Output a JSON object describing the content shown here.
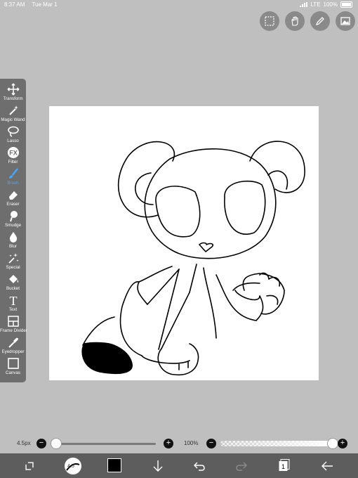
{
  "status_bar": {
    "time": "8:37 AM",
    "date": "Tue Mar 1",
    "network": "LTE",
    "battery": "100%"
  },
  "top_buttons": [
    "selection-icon",
    "hand-icon",
    "pencil-icon",
    "image-icon"
  ],
  "tools": [
    {
      "label": "Transform",
      "icon": "transform-icon"
    },
    {
      "label": "Magic Wand",
      "icon": "magic-wand-icon"
    },
    {
      "label": "Lasso",
      "icon": "lasso-icon"
    },
    {
      "label": "Filter",
      "icon": "filter-icon"
    },
    {
      "label": "Brush",
      "icon": "brush-icon",
      "active": true
    },
    {
      "label": "Eraser",
      "icon": "eraser-icon"
    },
    {
      "label": "Smudge",
      "icon": "smudge-icon"
    },
    {
      "label": "Blur",
      "icon": "blur-icon"
    },
    {
      "label": "Special",
      "icon": "special-icon"
    },
    {
      "label": "Bucket",
      "icon": "bucket-icon"
    },
    {
      "label": "Text",
      "icon": "text-icon"
    },
    {
      "label": "Frame Divider",
      "icon": "frame-divider-icon"
    },
    {
      "label": "Eyedropper",
      "icon": "eyedropper-icon"
    },
    {
      "label": "Canvas",
      "icon": "canvas-icon"
    }
  ],
  "filter_icon_text": "FX",
  "text_icon_text": "T",
  "brush_slider": {
    "value_label": "4.5px",
    "fraction": 0.05
  },
  "opacity_slider": {
    "value_label": "100%",
    "fraction": 1.0
  },
  "bottom_bar": {
    "brush_size": "4.5",
    "current_color": "#000000",
    "layer_count": "1"
  },
  "colors": {
    "background": "#bfbfbf",
    "toolbar": "#6e6e6e",
    "bottom_bar": "#5d5d5d",
    "accent": "#46a7ff"
  }
}
